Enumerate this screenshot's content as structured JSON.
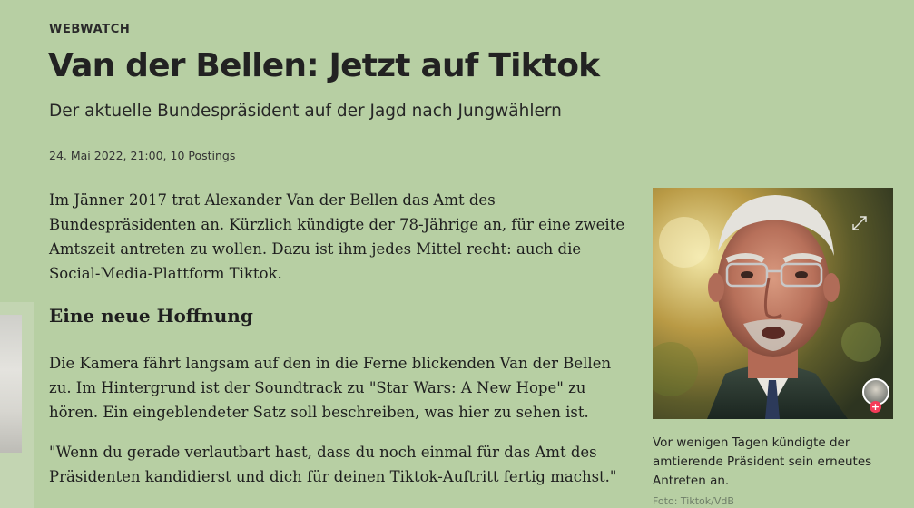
{
  "article": {
    "kicker": "WEBWATCH",
    "headline": "Van der Bellen: Jetzt auf Tiktok",
    "subheadline": "Der aktuelle Bundespräsident auf der Jagd nach Jungwählern",
    "date": "24. Mai 2022, 21:00,",
    "postings_link": "10 Postings",
    "paragraphs": [
      "Im Jänner 2017 trat Alexander Van der Bellen das Amt des Bundespräsidenten an. Kürzlich kündigte der 78-Jährige an, für eine zweite Amtszeit antreten zu wollen. Dazu ist ihm jedes Mittel recht: auch die Social-Media-Plattform Tiktok.",
      "Die Kamera fährt langsam auf den in die Ferne blickenden Van der Bellen zu. Im Hintergrund ist der Soundtrack zu \"Star Wars: A New Hope\" zu hören. Ein eingeblendeter Satz soll beschreiben, was hier zu sehen ist.",
      "\"Wenn du gerade verlautbart hast, dass du noch einmal für das Amt des Präsidenten kandidierst und dich für deinen Tiktok-Auftritt fertig machst.\""
    ],
    "section_heading": "Eine neue Hoffnung"
  },
  "image": {
    "caption": "Vor wenigen Tagen kündigte der amtierende Präsident sein erneutes Antreten an.",
    "credit": "Foto: Tiktok/VdB",
    "expand_icon": "expand-icon",
    "avatar_badge": "+"
  },
  "colors": {
    "page_background": "#b7cfa3",
    "text": "#1e1e1e",
    "tiktok_plus": "#f43b58"
  }
}
